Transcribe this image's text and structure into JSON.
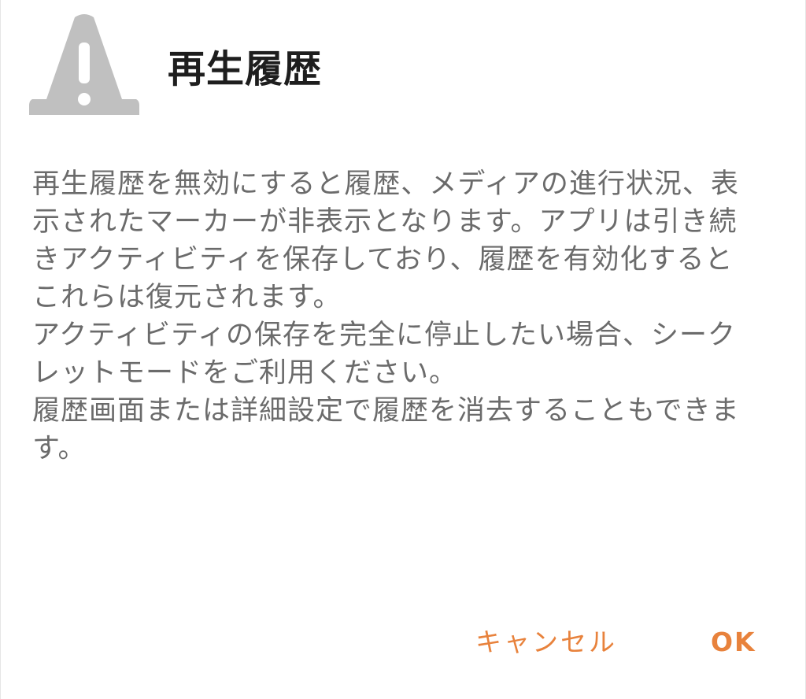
{
  "dialog": {
    "title": "再生履歴",
    "icon": "warning-icon",
    "message_lines": [
      "再生履歴を無効にすると履歴、メディアの進行状況、表",
      "示されたマーカーが非表示となります。アプリは引き続",
      "きアクティビティを保存しており、履歴を有効化すると",
      "これらは復元されます。",
      "アクティビティの保存を完全に停止したい場合、シーク",
      "レットモードをご利用ください。",
      "履歴画面または詳細設定で履歴を消去することもできま",
      "す。"
    ],
    "cancel_label": "キャンセル",
    "ok_label": "OK"
  },
  "colors": {
    "accent": "#e8823c",
    "icon": "#c0c0c0",
    "title": "#1e1e1e",
    "body_text": "#6b6b6b",
    "background": "#ffffff"
  }
}
